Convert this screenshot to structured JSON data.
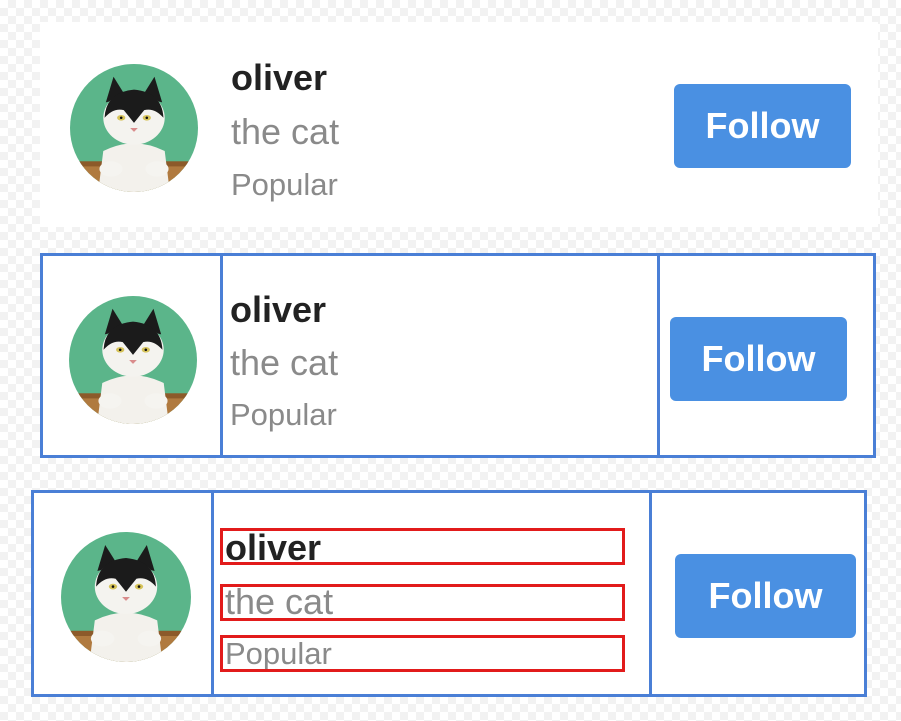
{
  "colors": {
    "accent": "#4a90e2",
    "column_outline": "#4a7fd6",
    "line_outline": "#e21b1b",
    "name_text": "#222222",
    "secondary_text": "#8a8a8a",
    "avatar_background": "#5bb58a"
  },
  "cards": [
    {
      "variant": "plain",
      "avatar_icon": "cat-photo-icon",
      "name": "oliver",
      "subtitle": "the cat",
      "meta": "Popular",
      "button_label": "Follow"
    },
    {
      "variant": "column-outlines",
      "avatar_icon": "cat-photo-icon",
      "name": "oliver",
      "subtitle": "the cat",
      "meta": "Popular",
      "button_label": "Follow"
    },
    {
      "variant": "column-and-line-outlines",
      "avatar_icon": "cat-photo-icon",
      "name": "oliver",
      "subtitle": "the cat",
      "meta": "Popular",
      "button_label": "Follow"
    }
  ]
}
